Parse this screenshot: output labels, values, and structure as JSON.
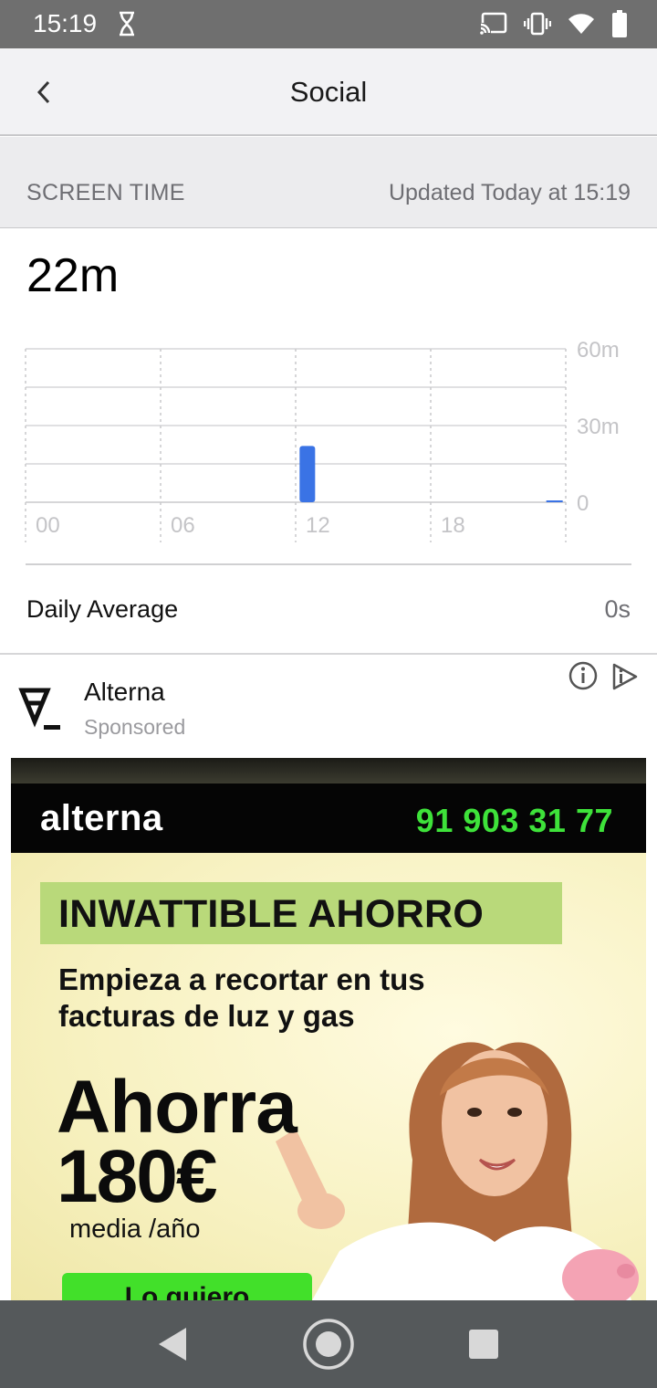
{
  "status_bar": {
    "time": "15:19",
    "icons": [
      "hourglass-icon",
      "cast-icon",
      "vibrate-icon",
      "wifi-icon",
      "battery-icon"
    ]
  },
  "header": {
    "title": "Social",
    "back_icon": "chevron-left-icon"
  },
  "section": {
    "title": "SCREEN TIME",
    "updated": "Updated Today at 15:19"
  },
  "total_time": "22m",
  "chart_data": {
    "type": "bar",
    "x_tick_labels": [
      "00",
      "06",
      "12",
      "18"
    ],
    "y_tick_labels": [
      "60m",
      "30m",
      "0"
    ],
    "ylim": [
      0,
      60
    ],
    "bars": [
      {
        "hour": 12,
        "minutes": 22
      },
      {
        "hour": 23,
        "minutes": 0.5
      }
    ],
    "bar_color": "#3a73e5",
    "grid": true
  },
  "daily_average": {
    "label": "Daily Average",
    "value": "0s"
  },
  "ad": {
    "advertiser": "Alterna",
    "sponsored_label": "Sponsored",
    "info_icon": "info-icon",
    "adchoices_icon": "adchoices-icon",
    "banner": {
      "brand": "alterna",
      "phone": "91 903 31 77",
      "headline": "INWATTIBLE AHORRO",
      "sub_line1": "Empieza a recortar en tus",
      "sub_line2": "facturas de luz y gas",
      "big_line1": "Ahorra",
      "big_line2": "180€",
      "small": "media /año",
      "cta": "Lo quiero",
      "phone_color": "#3ee23a",
      "highlight_color": "#b9d97a"
    }
  },
  "nav_bar": {
    "icons": [
      "nav-back-icon",
      "nav-home-icon",
      "nav-recents-icon"
    ]
  }
}
